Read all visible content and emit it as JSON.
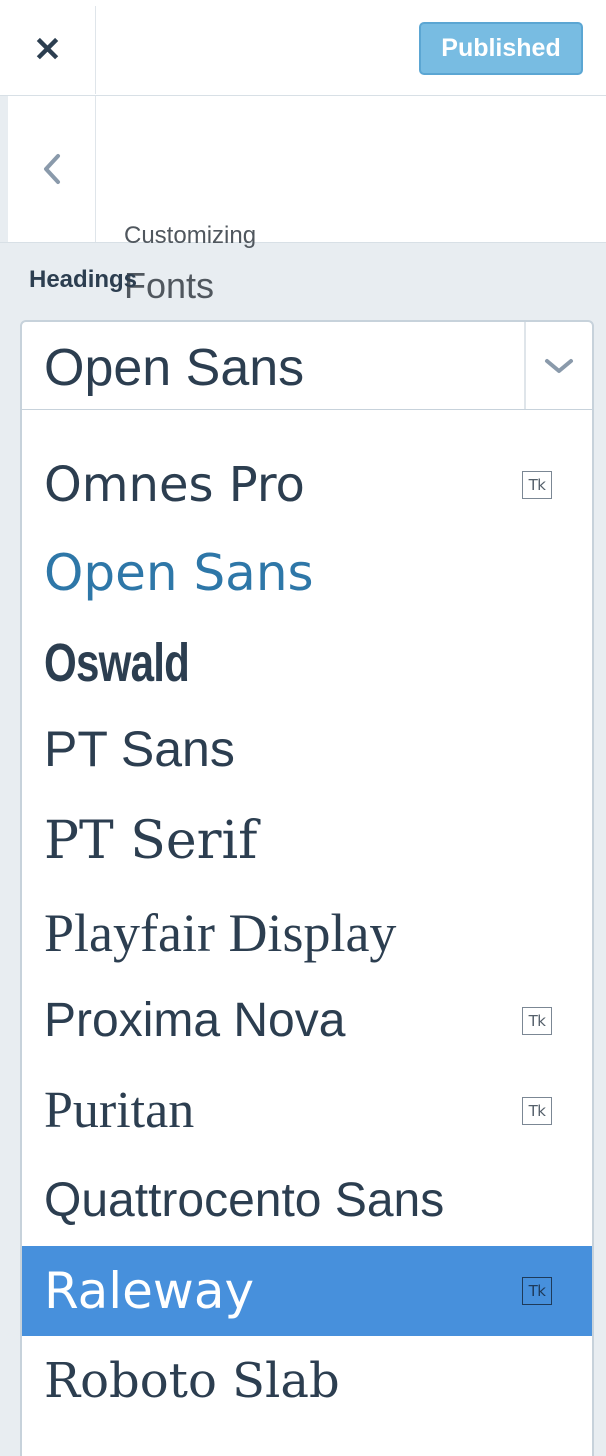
{
  "topbar": {
    "close_icon": "✕",
    "publish_label": "Published",
    "publish_color": "#78bce2"
  },
  "header": {
    "back_icon": "chevron-left-icon",
    "breadcrumb": "Customizing",
    "title": "Fonts"
  },
  "control": {
    "label": "Headings",
    "selected": "Open Sans"
  },
  "dropdown": {
    "items": [
      {
        "label": "Omnes Pro",
        "badge": "Tk"
      },
      {
        "label": "Open Sans",
        "badge": ""
      },
      {
        "label": "Oswald",
        "badge": ""
      },
      {
        "label": "PT Sans",
        "badge": ""
      },
      {
        "label": "PT Serif",
        "badge": ""
      },
      {
        "label": "Playfair Display",
        "badge": ""
      },
      {
        "label": "Proxima Nova",
        "badge": "Tk"
      },
      {
        "label": "Puritan",
        "badge": "Tk"
      },
      {
        "label": "Quattrocento Sans",
        "badge": ""
      },
      {
        "label": "Raleway",
        "badge": "Tk"
      },
      {
        "label": "Roboto Slab",
        "badge": ""
      }
    ],
    "highlight_color": "#4790dc",
    "current_color": "#2e77a8"
  }
}
